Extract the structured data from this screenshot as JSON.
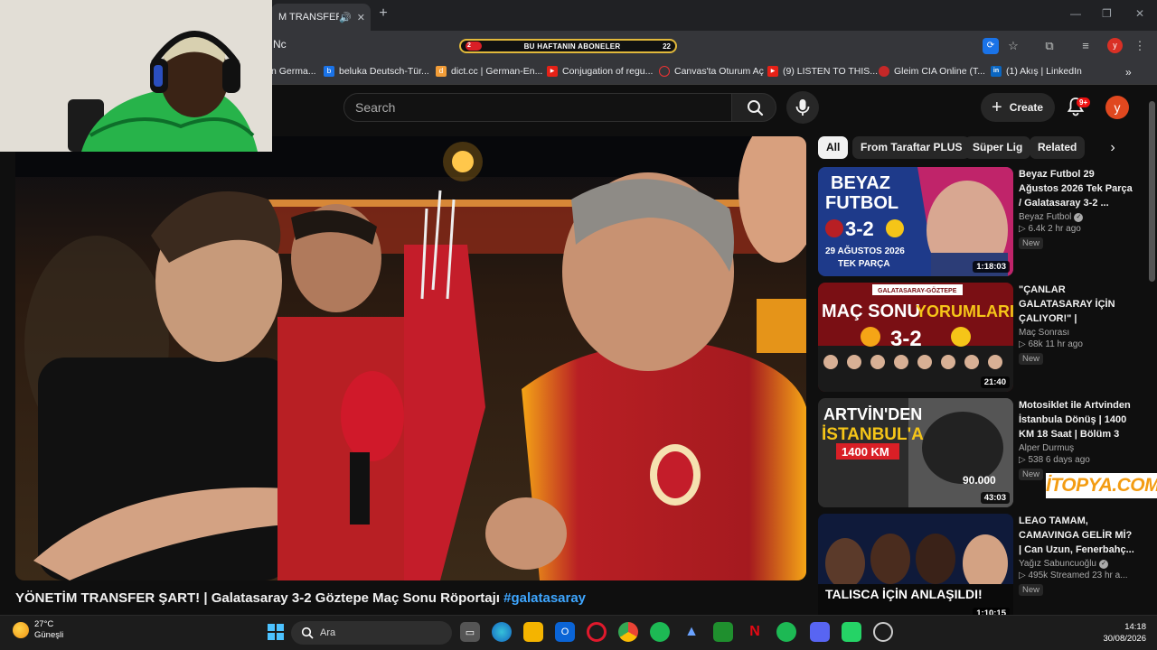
{
  "browser": {
    "tab_title": "M TRANSFER Ş",
    "url": "Nc",
    "ticker": {
      "left_score": "2",
      "label": "BU HAFTANIN ABONELER",
      "right_score": "22"
    },
    "profile_initial": "y",
    "bookmarks": [
      {
        "label": "n Germa...",
        "color": "#4285f4"
      },
      {
        "label": "beluka Deutsch-Tür...",
        "color": "#1a73e8"
      },
      {
        "label": "dict.cc | German-En...",
        "color": "#f29d38"
      },
      {
        "label": "Conjugation of regu...",
        "color": "#e62117"
      },
      {
        "label": "Canvas'ta Oturum Aç",
        "color": "#e33"
      },
      {
        "label": "(9) LISTEN TO THIS...",
        "color": "#e62117"
      },
      {
        "label": "Gleim CIA Online (T...",
        "color": "#c62828"
      },
      {
        "label": "(1) Akış | LinkedIn",
        "color": "#0a66c2"
      }
    ]
  },
  "youtube": {
    "search_placeholder": "Search",
    "create_label": "Create",
    "notif_count": "9+",
    "avatar_initial": "y",
    "chips": [
      "All",
      "From Taraftar PLUS",
      "Süper Lig",
      "Related"
    ],
    "video_title": "YÖNETİM TRANSFER ŞART! | Galatasaray 3-2 Göztepe Maç Sonu Röportajı",
    "video_hashtag": "#galatasaray",
    "recommendations": [
      {
        "title": "Beyaz Futbol 29 Ağustos 2026 Tek Parça / Galatasaray 3-2 ...",
        "channel": "Beyaz Futbol",
        "verified": true,
        "meta": "▷ 6.4k  2 hr ago",
        "badge": "New",
        "duration": "1:18:03",
        "thumb_text_1": "BEYAZ",
        "thumb_text_2": "FUTBOL",
        "thumb_score": "3-2",
        "thumb_text_3": "29 AĞUSTOS 2026",
        "thumb_text_4": "TEK PARÇA"
      },
      {
        "title": "\"ÇANLAR GALATASARAY İÇİN ÇALIYOR!\" | Galatasara...",
        "channel": "Maç Sonrası",
        "verified": false,
        "meta": "▷ 68k  11 hr ago",
        "badge": "New",
        "duration": "21:40",
        "thumb_text_1": "GALATASARAY-GÖZTEPE",
        "thumb_text_2": "MAÇ SONU",
        "thumb_text_3": "YORUMLARI",
        "thumb_score": "3-2"
      },
      {
        "title": "Motosiklet ile Artvinden İstanbula Dönüş | 1400 KM 18 Saat | Bölüm 3",
        "channel": "Alper Durmuş",
        "verified": false,
        "meta": "▷ 538  6 days ago",
        "badge": "New",
        "duration": "43:03",
        "thumb_text_1": "ARTVİN'DEN",
        "thumb_text_2": "İSTANBUL'A",
        "thumb_text_3": "1400 KM",
        "thumb_text_4": "90.000"
      },
      {
        "title": "LEAO TAMAM, CAMAVINGA GELİR Mİ? | Can Uzun, Fenerbahç...",
        "channel": "Yağız Sabuncuoğlu",
        "verified": true,
        "meta": "▷ 495k  Streamed 23 hr a...",
        "badge": "New",
        "duration": "1:10:15",
        "thumb_text_1": "TALISCA İÇİN ANLAŞILDI!"
      }
    ]
  },
  "watermark": "İTOPYA.COM",
  "taskbar": {
    "temperature": "27°C",
    "condition": "Güneşli",
    "search_placeholder": "Ara",
    "time": "14:18",
    "date": "30/08/2026"
  },
  "colors": {
    "accent_red": "#e0481f",
    "galatasaray_red": "#a9201f",
    "galatasaray_yellow": "#f5a516",
    "link_blue": "#3ea6ff"
  }
}
